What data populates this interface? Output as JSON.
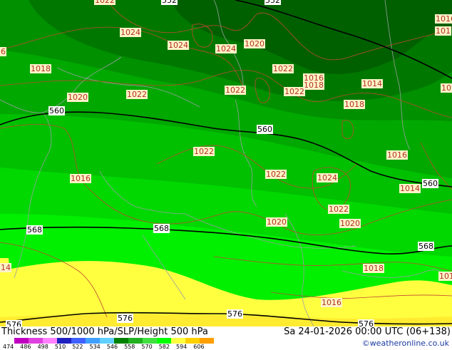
{
  "footer": {
    "title": "Thickness 500/1000 hPa/SLP/Height 500 hPa",
    "datetime": "Sa 24-01-2026 00:00 UTC (06+138)",
    "credit": "©weatheronline.co.uk"
  },
  "legend": {
    "ticks": [
      "474",
      "486",
      "498",
      "510",
      "522",
      "534",
      "546",
      "558",
      "570",
      "582",
      "594",
      "606"
    ],
    "colors": [
      "#c000c0",
      "#e040e0",
      "#ff80ff",
      "#2020c0",
      "#4060ff",
      "#40a0ff",
      "#60d0ff",
      "#008000",
      "#20b020",
      "#40e040",
      "#00ff00",
      "#ffff40",
      "#ffd000",
      "#ffa000"
    ]
  },
  "map": {
    "thickness_colors": [
      "#006000",
      "#007800",
      "#009000",
      "#00a800",
      "#00c000",
      "#00d800",
      "#00f000",
      "#ffff40",
      "#ffec30"
    ],
    "slp_labels": [
      {
        "t": "1022"
      },
      {
        "t": "1024"
      },
      {
        "t": "1024"
      },
      {
        "t": "1024"
      },
      {
        "t": "1020"
      },
      {
        "t": "1018"
      },
      {
        "t": "1020"
      },
      {
        "t": "1022"
      },
      {
        "t": "1022"
      },
      {
        "t": "1022"
      },
      {
        "t": "1016"
      },
      {
        "t": "1018"
      },
      {
        "t": "1014"
      },
      {
        "t": "1022"
      },
      {
        "t": "1018"
      },
      {
        "t": "1016"
      },
      {
        "t": "1016"
      },
      {
        "t": "1022"
      },
      {
        "t": "1022"
      },
      {
        "t": "1024"
      },
      {
        "t": "1016"
      },
      {
        "t": "1014"
      },
      {
        "t": "1022"
      },
      {
        "t": "1020"
      },
      {
        "t": "1020"
      },
      {
        "t": "1018"
      },
      {
        "t": "1016"
      },
      {
        "t": "101"
      },
      {
        "t": "101"
      },
      {
        "t": "101"
      },
      {
        "t": "14"
      },
      {
        "t": "6"
      }
    ],
    "height_labels": [
      {
        "t": "552"
      },
      {
        "t": "552"
      },
      {
        "t": "560"
      },
      {
        "t": "560"
      },
      {
        "t": "560"
      },
      {
        "t": "568"
      },
      {
        "t": "568"
      },
      {
        "t": "568"
      },
      {
        "t": "576"
      },
      {
        "t": "576"
      },
      {
        "t": "576"
      },
      {
        "t": "576"
      }
    ]
  }
}
